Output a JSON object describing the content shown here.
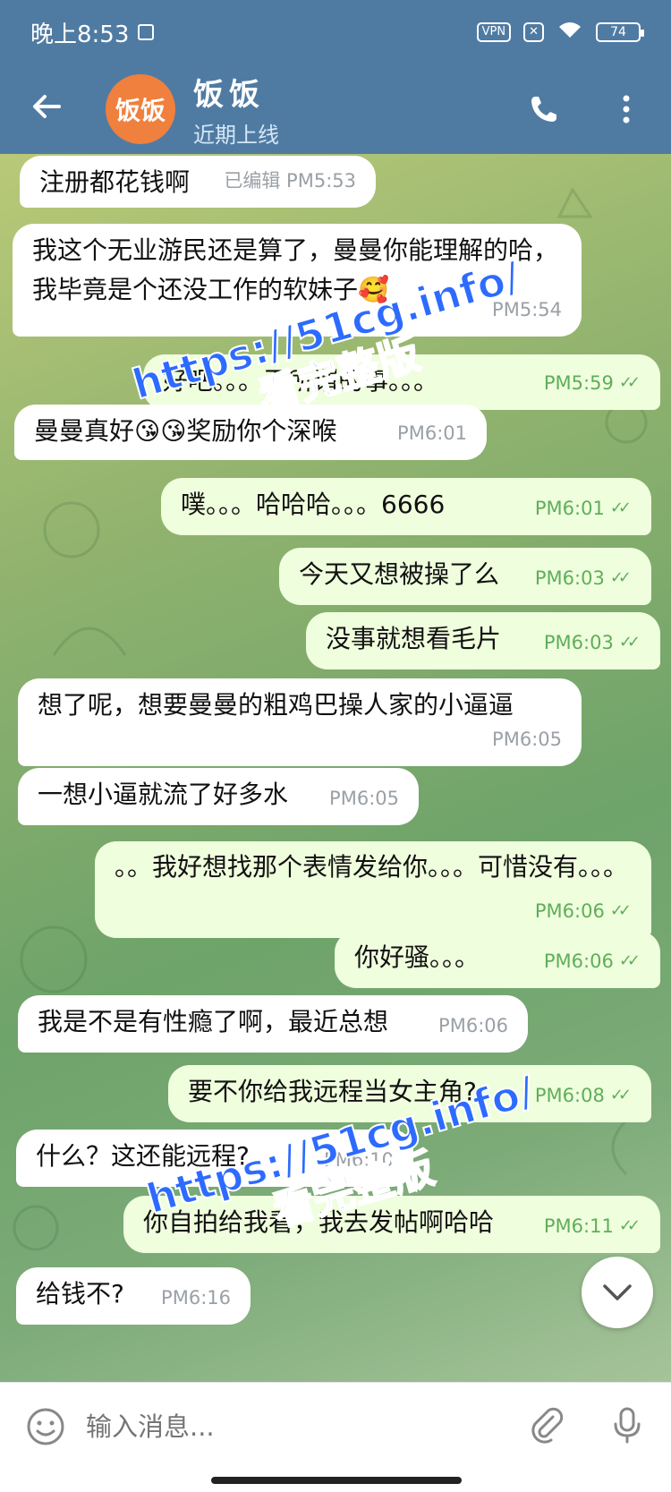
{
  "status_bar": {
    "time": "晚上8:53",
    "vpn": "VPN",
    "battery": "74"
  },
  "header": {
    "avatar_text": "饭饭",
    "name": "饭饭",
    "status": "近期上线"
  },
  "messages": [
    {
      "dir": "in",
      "text": "注册都花钱啊",
      "time": "已编辑 PM5:53"
    },
    {
      "dir": "in",
      "text": "我这个无业游民还是算了，曼曼你能理解的哈，我毕竟是个还没工作的软妹子🥰",
      "time": "PM5:54"
    },
    {
      "dir": "out",
      "text": "好吧。。。无所谓的事。。。",
      "time": "PM5:59"
    },
    {
      "dir": "in",
      "text": "曼曼真好😘😘奖励你个深喉",
      "time": "PM6:01"
    },
    {
      "dir": "out",
      "text": "噗。。。哈哈哈。。。6666",
      "time": "PM6:01"
    },
    {
      "dir": "out",
      "text": "今天又想被操了么",
      "time": "PM6:03"
    },
    {
      "dir": "out",
      "text": "没事就想看毛片",
      "time": "PM6:03"
    },
    {
      "dir": "in",
      "text": "想了呢，想要曼曼的粗鸡巴操人家的小逼逼",
      "time": "PM6:05"
    },
    {
      "dir": "in",
      "text": "一想小逼就流了好多水",
      "time": "PM6:05"
    },
    {
      "dir": "out",
      "text": "。。我好想找那个表情发给你。。。可惜没有。。。",
      "time": "PM6:06"
    },
    {
      "dir": "out",
      "text": "你好骚。。。",
      "time": "PM6:06"
    },
    {
      "dir": "in",
      "text": "我是不是有性瘾了啊，最近总想",
      "time": "PM6:06"
    },
    {
      "dir": "out",
      "text": "要不你给我远程当女主角?",
      "time": "PM6:08"
    },
    {
      "dir": "in",
      "text": "什么？这还能远程?",
      "time": "PM6:10"
    },
    {
      "dir": "out",
      "text": "你自拍给我看，我去发帖啊哈哈",
      "time": "PM6:11"
    },
    {
      "dir": "in",
      "text": "给钱不?",
      "time": "PM6:16"
    }
  ],
  "watermark": {
    "url": "https://51cg.info/",
    "text": "看完整版"
  },
  "composer": {
    "placeholder": "输入消息..."
  },
  "icons": {
    "back": "back-arrow-icon",
    "call": "phone-icon",
    "more": "more-vertical-icon",
    "emoji": "emoji-icon",
    "attach": "paperclip-icon",
    "mic": "microphone-icon",
    "scroll": "chevron-down-icon"
  },
  "colors": {
    "header": "#4f7ba3",
    "avatar": "#f0803d",
    "incoming_bubble": "#ffffff",
    "outgoing_bubble": "#effedd",
    "outgoing_time": "#5fae5a"
  }
}
